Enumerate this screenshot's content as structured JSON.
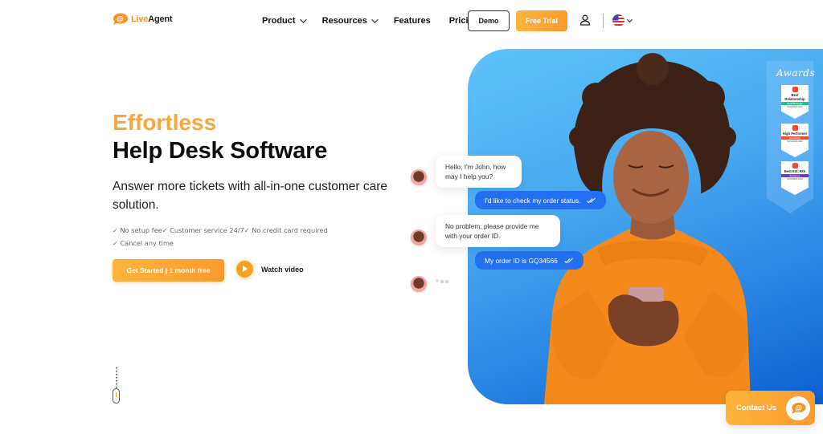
{
  "brand": {
    "name_part1": "Live",
    "name_part2": "Agent",
    "accent": "#f9a63a",
    "primary_blue": "#2270f0"
  },
  "nav": {
    "items": [
      {
        "label": "Product",
        "has_dropdown": true
      },
      {
        "label": "Resources",
        "has_dropdown": true
      },
      {
        "label": "Features",
        "has_dropdown": false
      },
      {
        "label": "Pricing",
        "has_dropdown": false
      }
    ],
    "demo_label": "Demo",
    "trial_label": "Free Trial",
    "user_icon": "user-icon",
    "language_icon": "us-flag-icon"
  },
  "hero": {
    "headline_accent": "Effortless",
    "headline": "Help Desk Software",
    "subtitle": "Answer more tickets with all-in-one customer care solution.",
    "checks_line1": "✓ No setup fee✓ Customer service 24/7✓ No credit card required",
    "checks_line2": "✓ Cancel any time",
    "cta_label": "Get Started | 1 month free",
    "watch_label": "Watch video"
  },
  "chat": {
    "messages": [
      {
        "from": "agent",
        "text": "Hello, I'm John, how may I help you?"
      },
      {
        "from": "user",
        "text": "I'd like to check my order status.",
        "status": "read"
      },
      {
        "from": "agent",
        "text": "No problem, please provide me with your order ID."
      },
      {
        "from": "user",
        "text": "My order ID is GQ34566",
        "status": "read"
      },
      {
        "from": "agent",
        "typing": true
      }
    ]
  },
  "awards": {
    "title": "Awards",
    "badges": [
      {
        "title": "Best Relationship",
        "strip": "Small Business",
        "strip_color": "#1ec68b",
        "season": "SUMMER 2022"
      },
      {
        "title": "High Performer",
        "strip": "Mid-Market",
        "strip_color": "#ef4b2f",
        "season": "SUMMER 2022"
      },
      {
        "title": "Best Est. ROI",
        "strip": "Enterprise",
        "strip_color": "#6b3fc2",
        "season": "SUMMER 2022"
      }
    ]
  },
  "contact": {
    "label": "Contact Us"
  }
}
